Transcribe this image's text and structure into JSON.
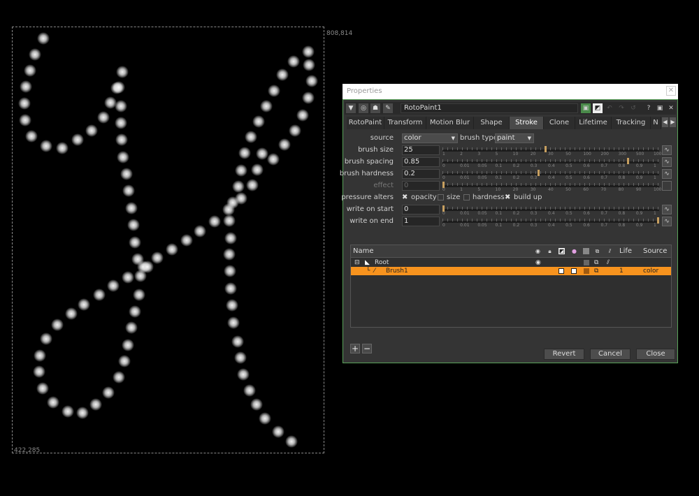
{
  "viewer": {
    "coord_top_right": "808,814",
    "coord_bottom_left": "422,285"
  },
  "properties": {
    "window_title": "Properties",
    "close_glyph": "✕",
    "node_name": "RotoPaint1",
    "toolbar_icons": [
      "collapse-arrow-icon",
      "center-node-icon",
      "bug-icon",
      "wrench-icon"
    ],
    "tabs": [
      "RotoPaint",
      "Transform",
      "Motion Blur",
      "Shape",
      "Stroke",
      "Clone",
      "Lifetime",
      "Tracking",
      "N"
    ],
    "active_tab": "Stroke",
    "source": {
      "label": "source",
      "value": "color"
    },
    "brush_type": {
      "label": "brush type",
      "value": "paint"
    },
    "brush_size": {
      "label": "brush size",
      "value": "25",
      "position": 0.47,
      "ticks": [
        "1",
        "2",
        "3",
        "5",
        "10",
        "20",
        "30",
        "50",
        "100",
        "200",
        "300",
        "500",
        "1000"
      ]
    },
    "brush_spacing": {
      "label": "brush spacing",
      "value": "0.85",
      "position": 0.85,
      "ticks": [
        "0",
        "0.01",
        "0.05",
        "0.1",
        "0.2",
        "0.3",
        "0.4",
        "0.5",
        "0.6",
        "0.7",
        "0.8",
        "0.9",
        "1"
      ]
    },
    "brush_hardness": {
      "label": "brush hardness",
      "value": "0.2",
      "position": 0.44,
      "ticks": [
        "0",
        "0.01",
        "0.05",
        "0.1",
        "0.2",
        "0.3",
        "0.4",
        "0.5",
        "0.6",
        "0.7",
        "0.8",
        "0.9",
        "1"
      ]
    },
    "effect": {
      "label": "effect",
      "value": "0",
      "position": 0.0,
      "ticks": [
        "0",
        "1",
        "5",
        "10",
        "20",
        "30",
        "40",
        "50",
        "60",
        "70",
        "80",
        "90",
        "100"
      ]
    },
    "pressure_alters": {
      "label": "pressure alters",
      "options": [
        {
          "name": "opacity",
          "checked": true
        },
        {
          "name": "size",
          "checked": false
        },
        {
          "name": "hardness",
          "checked": false
        },
        {
          "name": "build up",
          "checked": true
        }
      ]
    },
    "write_on_start": {
      "label": "write on start",
      "value": "0",
      "position": 0.0,
      "ticks": [
        "0",
        "0.01",
        "0.05",
        "0.1",
        "0.2",
        "0.3",
        "0.4",
        "0.5",
        "0.6",
        "0.7",
        "0.8",
        "0.9",
        "1"
      ]
    },
    "write_on_end": {
      "label": "write on end",
      "value": "1",
      "position": 1.0,
      "ticks": [
        "0",
        "0.01",
        "0.05",
        "0.1",
        "0.2",
        "0.3",
        "0.4",
        "0.5",
        "0.6",
        "0.7",
        "0.8",
        "0.9",
        "1"
      ]
    },
    "tree": {
      "columns": {
        "name": "Name",
        "life": "Life",
        "source": "Source"
      },
      "rows": [
        {
          "name": "Root",
          "life": "",
          "source": ""
        },
        {
          "name": "Brush1",
          "life": "1",
          "source": "color"
        }
      ]
    },
    "add_label": "+",
    "remove_label": "−",
    "buttons": {
      "revert": "Revert",
      "cancel": "Cancel",
      "close": "Close"
    },
    "colors": {
      "accent_selected": "#f7931e",
      "border_green": "#5aa35a",
      "slider_handle": "#c8a060"
    }
  }
}
